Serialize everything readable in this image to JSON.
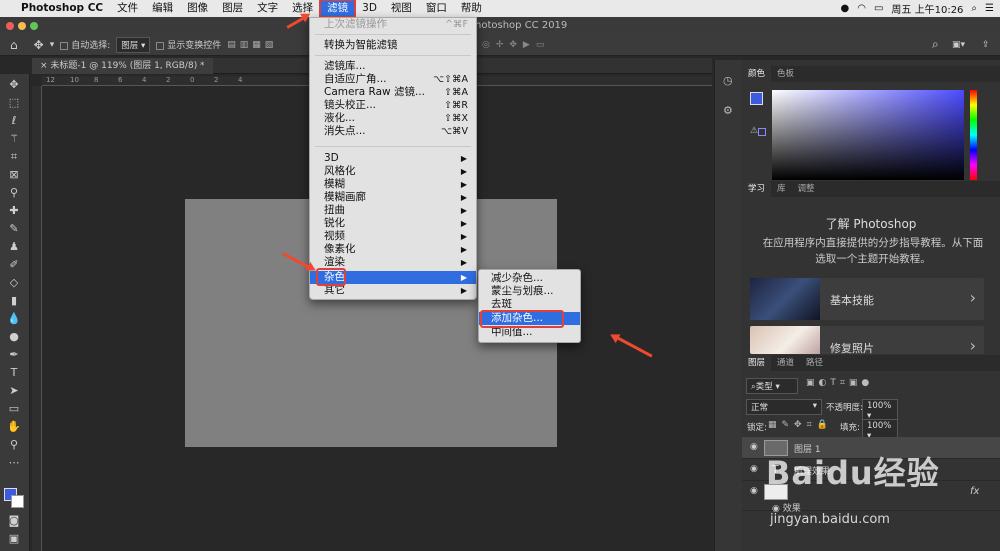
{
  "menubar": {
    "apple": "",
    "app": "Photoshop CC",
    "items": [
      "文件",
      "编辑",
      "图像",
      "图层",
      "文字",
      "选择",
      "滤镜",
      "3D",
      "视图",
      "窗口",
      "帮助"
    ],
    "clock": "周五 上午10:26"
  },
  "window": {
    "title": "hotoshop CC 2019"
  },
  "options": {
    "auto_select": "自动选择:",
    "layer_select": "图层",
    "show_transform": "显示变换控件"
  },
  "document_tab": {
    "label": "未标题-1 @ 119% (图层 1, RGB/8) *"
  },
  "ruler_ticks": [
    "12",
    "10",
    "8",
    "6",
    "4",
    "2",
    "0",
    "2",
    "4"
  ],
  "filter_menu": {
    "last_filter": {
      "label": "上次滤镜操作",
      "shortcut": "^⌘F"
    },
    "smart": "转换为智能滤镜",
    "group2": [
      {
        "label": "滤镜库...",
        "shortcut": ""
      },
      {
        "label": "自适应广角...",
        "shortcut": "⌥⇧⌘A"
      },
      {
        "label": "Camera Raw 滤镜...",
        "shortcut": "⇧⌘A"
      },
      {
        "label": "镜头校正...",
        "shortcut": "⇧⌘R"
      },
      {
        "label": "液化...",
        "shortcut": "⇧⌘X"
      },
      {
        "label": "消失点...",
        "shortcut": "⌥⌘V"
      }
    ],
    "group3": [
      "3D",
      "风格化",
      "模糊",
      "模糊画廊",
      "扭曲",
      "锐化",
      "视频",
      "像素化",
      "渲染",
      "杂色",
      "其它"
    ]
  },
  "noise_submenu": [
    "减少杂色...",
    "蒙尘与划痕...",
    "去斑",
    "添加杂色...",
    "中间值..."
  ],
  "color_panel": {
    "tabs": [
      "颜色",
      "色板"
    ],
    "fg": "#3d5be0"
  },
  "learn_panel": {
    "tabs": [
      "学习",
      "库",
      "调整"
    ],
    "title": "了解 Photoshop",
    "desc": "在应用程序内直接提供的分步指导教程。从下面选取一个主题开始教程。",
    "cards": [
      "基本技能",
      "修复照片"
    ]
  },
  "layers_panel": {
    "tabs": [
      "图层",
      "通道",
      "路径"
    ],
    "filter": "类型",
    "blend": "正常",
    "opacity_label": "不透明度:",
    "opacity": "100%",
    "lock_label": "锁定:",
    "fill_label": "填充:",
    "fill": "100%",
    "layers": [
      "图层 1",
      "肌理效果",
      "效果"
    ],
    "fx": "fx"
  },
  "watermark": {
    "brand": "Baidu经验",
    "url": "jingyan.baidu.com"
  }
}
